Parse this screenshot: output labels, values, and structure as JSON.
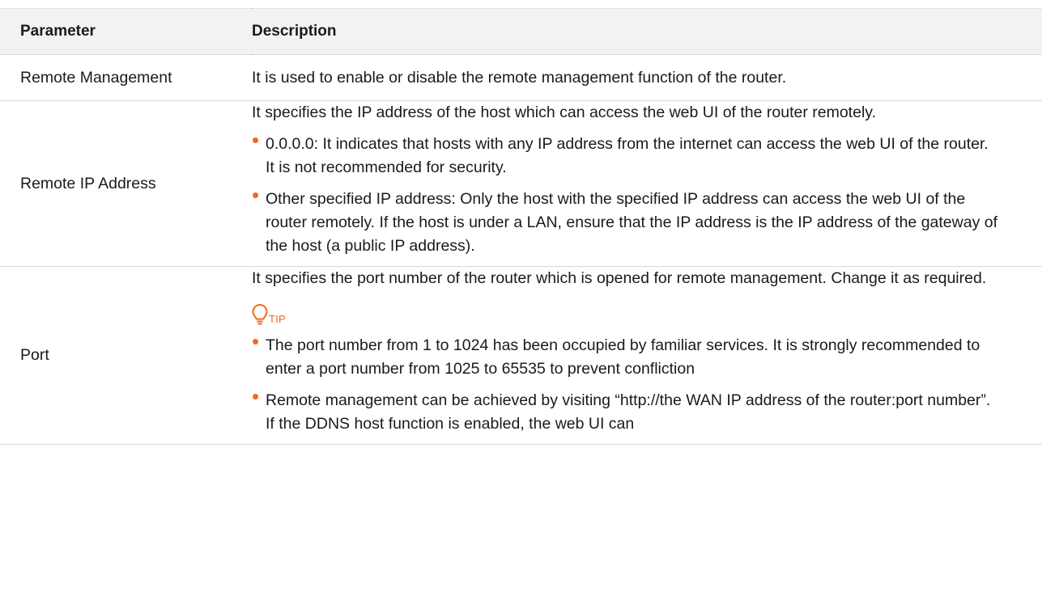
{
  "table": {
    "headers": {
      "parameter": "Parameter",
      "description": "Description"
    },
    "rows": {
      "remote_management": {
        "parameter": "Remote Management",
        "description": "It is used to enable or disable the remote management function of the router."
      },
      "remote_ip": {
        "parameter": "Remote IP Address",
        "intro": "It specifies the IP address of the host which can access the web UI of the router remotely.",
        "bullets": [
          "0.0.0.0: It indicates that hosts with any IP address from the internet can access the web UI of the router. It is not recommended for security.",
          "Other specified IP address: Only the host with the specified IP address can access the web UI of the router remotely. If the host is under a LAN, ensure that the IP address is the IP address of the gateway of the host (a public IP address)."
        ]
      },
      "port": {
        "parameter": "Port",
        "intro": "It specifies the port number of the router which is opened for remote management. Change it as required.",
        "tip_label": "TIP",
        "tip_icon": "lightbulb-icon",
        "bullets": [
          "The port number from 1 to 1024 has been occupied by familiar services. It is strongly recommended to enter a port number from 1025 to 65535 to prevent confliction",
          "Remote management can be achieved by visiting “http://the WAN IP address of the router:port number”. If the DDNS host function is enabled, the web UI can"
        ]
      }
    }
  },
  "colors": {
    "accent": "#f26a1b",
    "header_bg": "#f2f2f2",
    "text": "#1a1a1a",
    "rule": "#d9d9d9"
  }
}
